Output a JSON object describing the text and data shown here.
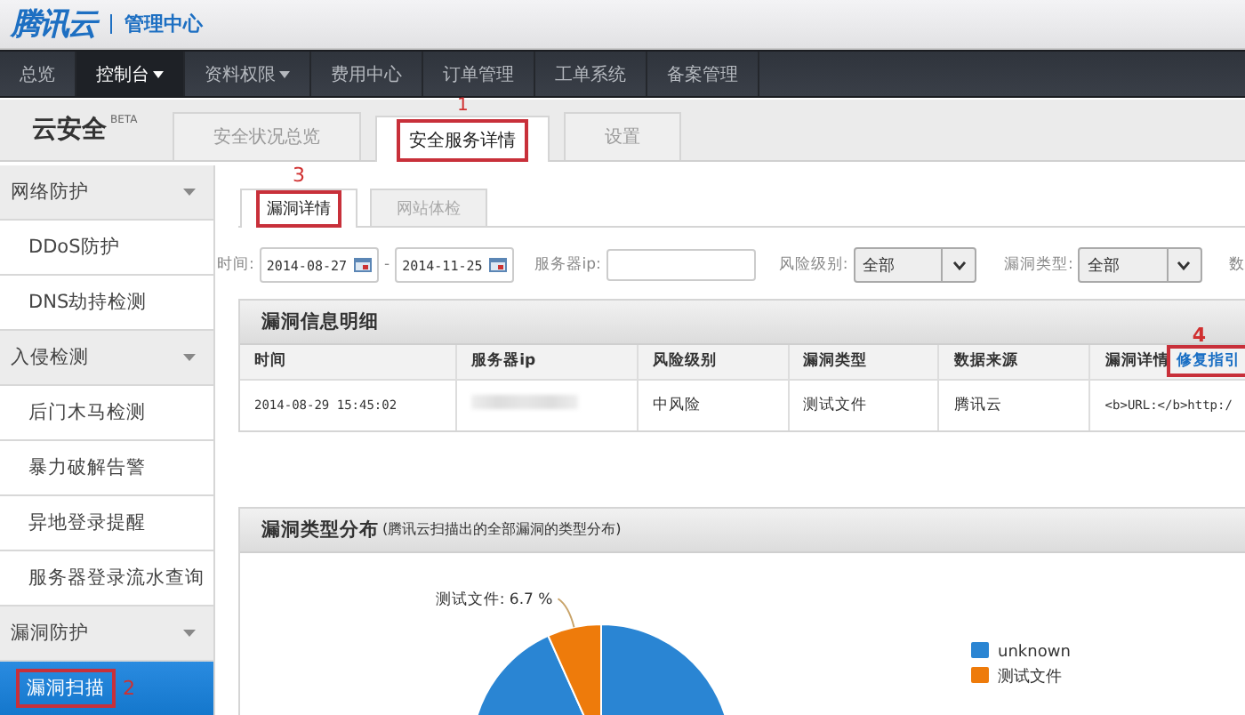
{
  "header": {
    "logo": "腾讯云",
    "title": "管理中心"
  },
  "nav": [
    {
      "label": "总览",
      "selected": false,
      "dropdown": false
    },
    {
      "label": "控制台",
      "selected": true,
      "dropdown": true
    },
    {
      "label": "资料权限",
      "selected": false,
      "dropdown": true
    },
    {
      "label": "费用中心",
      "selected": false,
      "dropdown": false
    },
    {
      "label": "订单管理",
      "selected": false,
      "dropdown": false
    },
    {
      "label": "工单系统",
      "selected": false,
      "dropdown": false
    },
    {
      "label": "备案管理",
      "selected": false,
      "dropdown": false
    }
  ],
  "product": {
    "name": "云安全",
    "badge": "BETA"
  },
  "tabs": [
    {
      "label": "安全状况总览",
      "selected": false
    },
    {
      "label": "安全服务详情",
      "selected": true,
      "annotation": "1"
    },
    {
      "label": "设置",
      "selected": false
    }
  ],
  "sidebar": {
    "groups": [
      {
        "label": "网络防护",
        "expanded": true,
        "children": [
          {
            "label": "DDoS防护",
            "selected": false
          },
          {
            "label": "DNS劫持检测",
            "selected": false
          }
        ]
      },
      {
        "label": "入侵检测",
        "expanded": true,
        "children": [
          {
            "label": "后门木马检测",
            "selected": false
          },
          {
            "label": "暴力破解告警",
            "selected": false
          },
          {
            "label": "异地登录提醒",
            "selected": false
          },
          {
            "label": "服务器登录流水查询",
            "selected": false
          }
        ]
      },
      {
        "label": "漏洞防护",
        "expanded": true,
        "children": [
          {
            "label": "漏洞扫描",
            "selected": true,
            "annotation": "2"
          }
        ]
      }
    ]
  },
  "subtabs": [
    {
      "label": "漏洞详情",
      "selected": true,
      "annotation": "3"
    },
    {
      "label": "网站体检",
      "selected": false
    }
  ],
  "filters": {
    "time_label": "时间:",
    "date_from": "2014-08-27",
    "separator": "-",
    "date_to": "2014-11-25",
    "server_ip_label": "服务器ip:",
    "risk_label": "风险级别:",
    "risk_value": "全部",
    "type_label": "漏洞类型:",
    "type_value": "全部",
    "column_5_label": "数"
  },
  "table": {
    "title": "漏洞信息明细",
    "columns": [
      {
        "label": "时间"
      },
      {
        "label": "服务器ip"
      },
      {
        "label": "风险级别"
      },
      {
        "label": "漏洞类型"
      },
      {
        "label": "数据来源"
      },
      {
        "label": "漏洞详情",
        "link": "修复指引",
        "annotation": "4"
      }
    ],
    "rows": [
      [
        "2014-08-29 15:45:02",
        "",
        "中风险",
        "测试文件",
        "腾讯云",
        "<b>URL:</b>http:/"
      ]
    ]
  },
  "chart_panel": {
    "title": "漏洞类型分布",
    "subtitle": "(腾讯云扫描出的全部漏洞的类型分布)",
    "chart_data": {
      "type": "pie",
      "categories": [
        "unknown",
        "测试文件"
      ],
      "values": [
        93.3,
        6.7
      ],
      "legend": true,
      "colors": [
        "#2a85d3",
        "#ee7b0b"
      ],
      "value_labels": [
        null,
        "测试文件: 6.7 %"
      ]
    }
  }
}
